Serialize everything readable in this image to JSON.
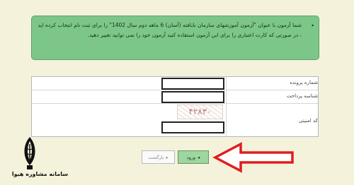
{
  "notice": {
    "text": "شما آزمون با عنوان \"آزمون آموزشهای سازمان نابافته (آسان) 6 ماهه دوم سال 1402\" را برای ثبت نام انتخاب کرده اید ، در صورتی که کارت اعتباری را برای این آزمون استفاده کنید آزمون خود را نمی توانید تغییر دهید."
  },
  "form": {
    "fields": [
      {
        "label": "شماره پرونده",
        "value": ""
      },
      {
        "label": "شناسه پرداخت",
        "value": ""
      },
      {
        "label": "کد امنیتی",
        "value": ""
      }
    ],
    "captcha_text": "۴۲۸۳۰"
  },
  "buttons": {
    "back_label": "بازگشت",
    "enter_label": "ورود"
  },
  "branding": {
    "logo_text": "سامانه مشاوره هیوا"
  },
  "colors": {
    "background": "#f5f2dc",
    "notice_bg": "#7dc68a",
    "enter_button": "#9fd59f",
    "annotation_arrow": "#e11d1d"
  },
  "icons": {
    "notice_bullet": "bullet-icon",
    "back": "back-arrow-icon",
    "enter": "enter-arrow-icon",
    "annotation": "annotation-arrow-icon",
    "logo": "hiva-logo-icon"
  }
}
